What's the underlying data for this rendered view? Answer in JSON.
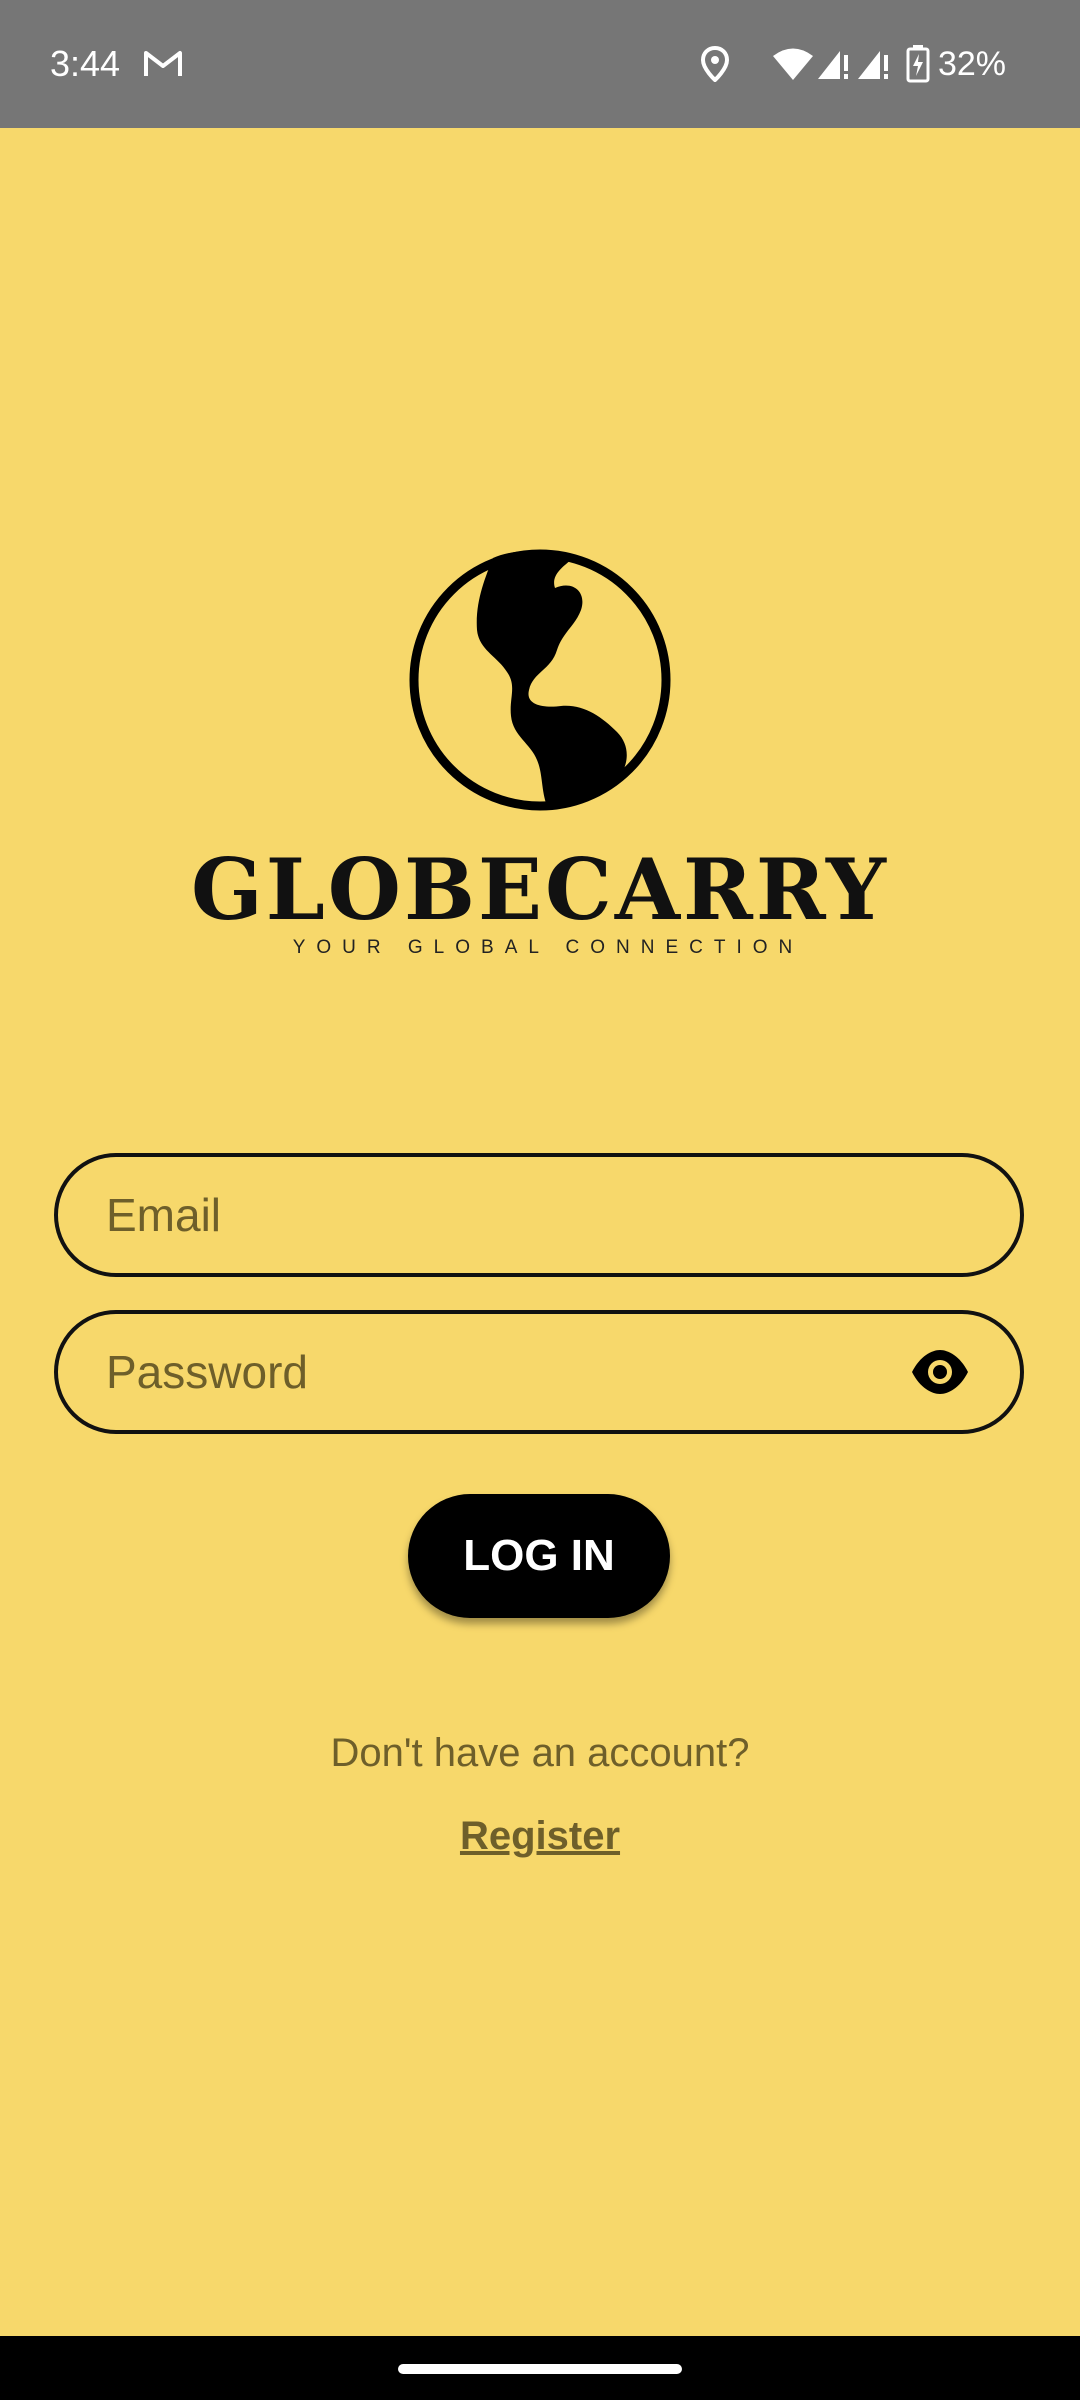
{
  "status_bar": {
    "time": "3:44",
    "battery_percent": "32%",
    "icons": [
      "gmail-icon",
      "location-icon",
      "wifi-icon",
      "cell-signal-icon",
      "cell-signal-icon",
      "battery-charging-icon"
    ]
  },
  "logo": {
    "icon": "globe-icon",
    "brand_name": "GLOBECARRY",
    "tagline": "YOUR GLOBAL CONNECTION"
  },
  "form": {
    "email_placeholder": "Email",
    "password_placeholder": "Password",
    "password_toggle_icon": "eye-icon",
    "login_label": "LOG IN"
  },
  "footer": {
    "no_account_text": "Don't have an account?",
    "register_label": "Register"
  },
  "colors": {
    "background": "#F7D86B",
    "status_bar": "#767676",
    "primary_text": "#111111",
    "muted_text": "#6E5F2A",
    "button": "#000000"
  }
}
